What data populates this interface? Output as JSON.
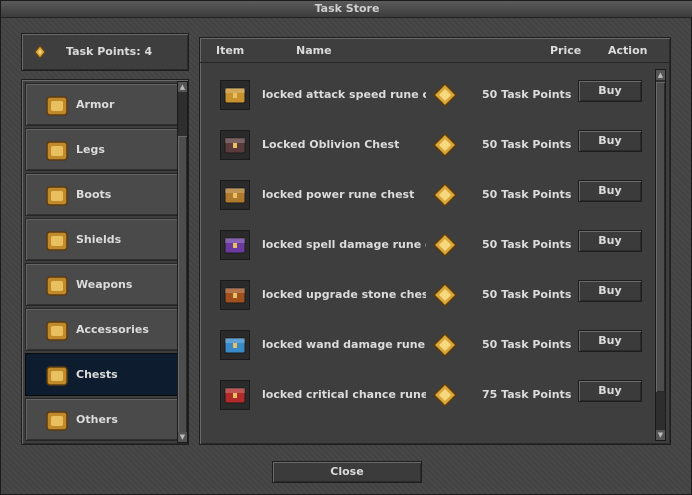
{
  "window": {
    "title": "Task Store"
  },
  "points": {
    "label": "Task Points: 4"
  },
  "categories": [
    {
      "label": "Armor",
      "icon": "armor-icon"
    },
    {
      "label": "Legs",
      "icon": "legs-icon"
    },
    {
      "label": "Boots",
      "icon": "boots-icon"
    },
    {
      "label": "Shields",
      "icon": "shield-icon"
    },
    {
      "label": "Weapons",
      "icon": "bow-icon"
    },
    {
      "label": "Accessories",
      "icon": "amulet-icon"
    },
    {
      "label": "Chests",
      "icon": "chest-icon",
      "active": true
    },
    {
      "label": "Others",
      "icon": "bag-icon"
    }
  ],
  "table": {
    "headers": {
      "item": "Item",
      "name": "Name",
      "price": "Price",
      "action": "Action"
    },
    "rows": [
      {
        "name": "locked attack speed rune ch",
        "price": "50 Task Points",
        "action": "Buy",
        "chest_color": "#c8932e"
      },
      {
        "name": "Locked Oblivion Chest",
        "price": "50 Task Points",
        "action": "Buy",
        "chest_color": "#5a3a3a"
      },
      {
        "name": "locked power rune chest",
        "price": "50 Task Points",
        "action": "Buy",
        "chest_color": "#b07a2e"
      },
      {
        "name": "locked spell damage rune che",
        "price": "50 Task Points",
        "action": "Buy",
        "chest_color": "#6a3aa0"
      },
      {
        "name": "locked upgrade stone chest",
        "price": "50 Task Points",
        "action": "Buy",
        "chest_color": "#a0501e"
      },
      {
        "name": "locked wand damage rune ch",
        "price": "50 Task Points",
        "action": "Buy",
        "chest_color": "#3a8ac8"
      },
      {
        "name": "locked critical chance rune c",
        "price": "75 Task Points",
        "action": "Buy",
        "chest_color": "#b02a2a"
      }
    ]
  },
  "footer": {
    "close_label": "Close"
  },
  "colors": {
    "active_category_bg": "#0d1c2e",
    "coin_gold": "#d9a63a"
  }
}
